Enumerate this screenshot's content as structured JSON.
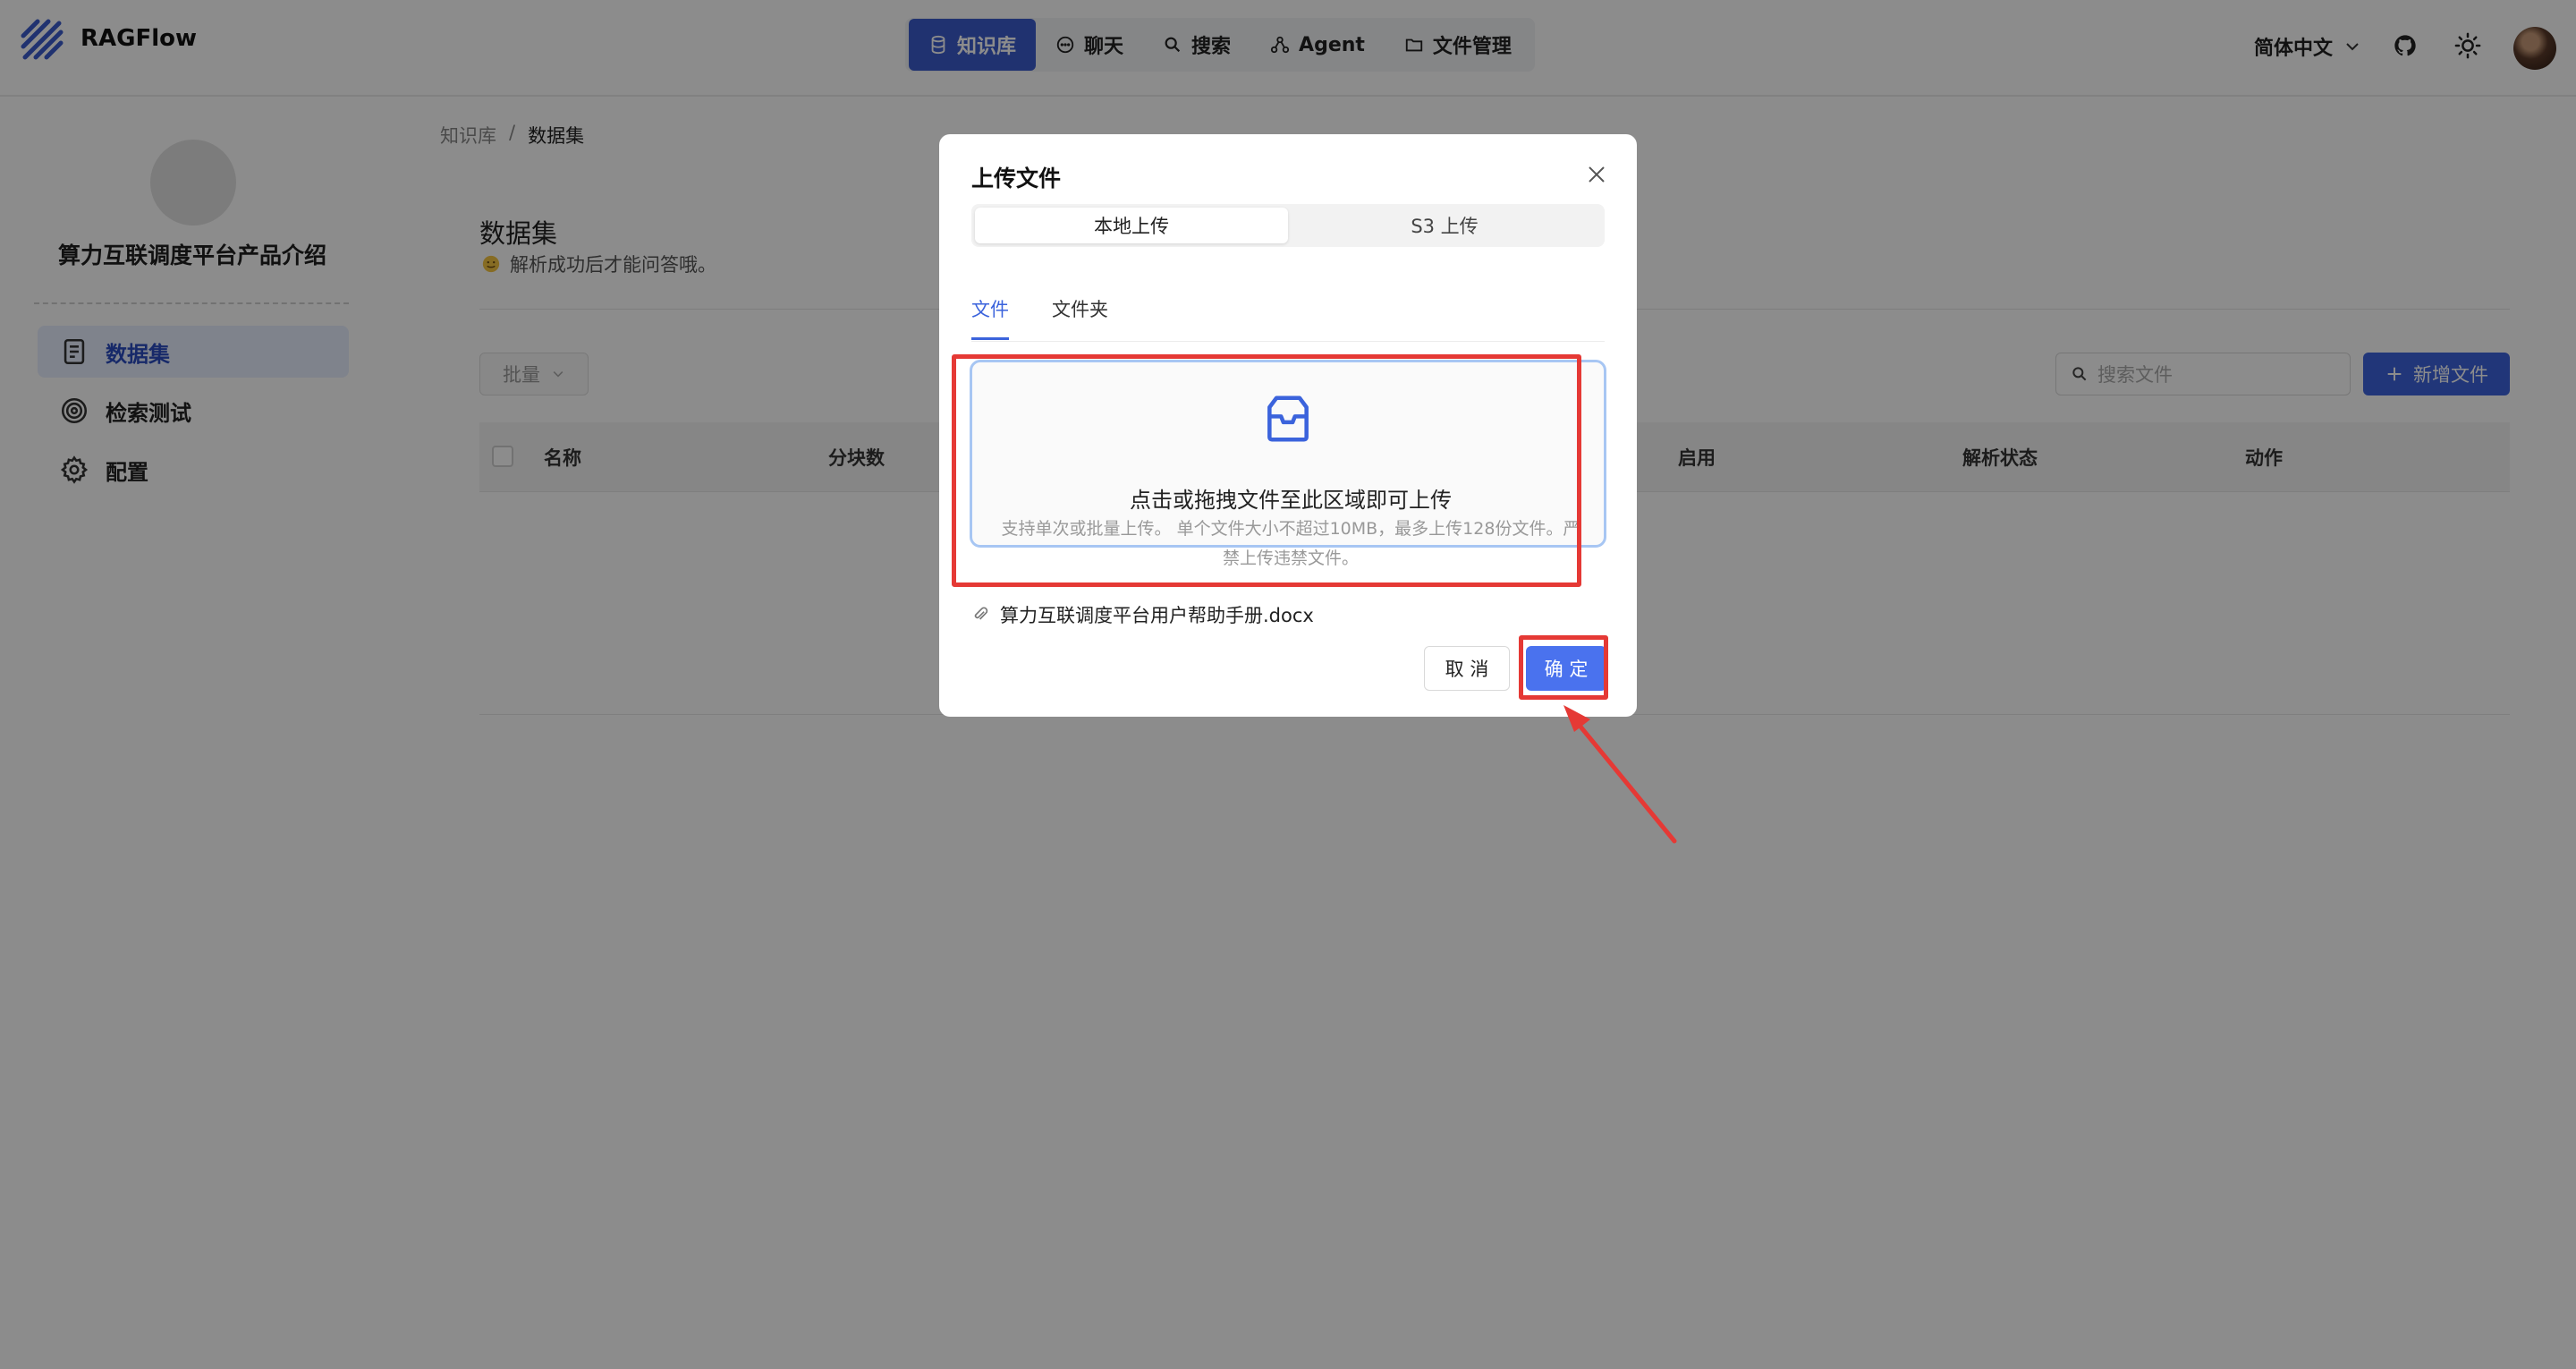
{
  "app": {
    "name": "RAGFlow"
  },
  "topnav": {
    "items": [
      {
        "label": "知识库",
        "icon": "database-icon",
        "active": true
      },
      {
        "label": "聊天",
        "icon": "chat-icon",
        "active": false
      },
      {
        "label": "搜索",
        "icon": "search-icon",
        "active": false
      },
      {
        "label": "Agent",
        "icon": "agent-icon",
        "active": false
      },
      {
        "label": "文件管理",
        "icon": "folder-icon",
        "active": false
      }
    ],
    "language": "简体中文"
  },
  "sidebar": {
    "kb_name": "算力互联调度平台产品介绍",
    "items": [
      {
        "label": "数据集",
        "icon": "document-icon",
        "active": true
      },
      {
        "label": "检索测试",
        "icon": "target-icon",
        "active": false
      },
      {
        "label": "配置",
        "icon": "gear-icon",
        "active": false
      }
    ]
  },
  "main": {
    "breadcrumb": [
      "知识库",
      "数据集"
    ],
    "title": "数据集",
    "subtitle": "解析成功后才能问答哦。",
    "batch_label": "批量",
    "search_placeholder": "搜索文件",
    "add_label": "新增文件",
    "columns": [
      "名称",
      "分块数",
      "启用",
      "解析状态",
      "动作"
    ]
  },
  "modal": {
    "title": "上传文件",
    "segments": [
      "本地上传",
      "S3 上传"
    ],
    "tabs": [
      "文件",
      "文件夹"
    ],
    "dropzone_title": "点击或拖拽文件至此区域即可上传",
    "dropzone_hint": "支持单次或批量上传。 单个文件大小不超过10MB，最多上传128份文件。严禁上传违禁文件。",
    "file_name": "算力互联调度平台用户帮助手册.docx",
    "cancel_label": "取 消",
    "ok_label": "确 定"
  },
  "colors": {
    "accent": "#3b5ccc",
    "primary_button": "#4a72ee",
    "annotation": "#e53935",
    "dropzone_border": "#a7c6f3"
  }
}
